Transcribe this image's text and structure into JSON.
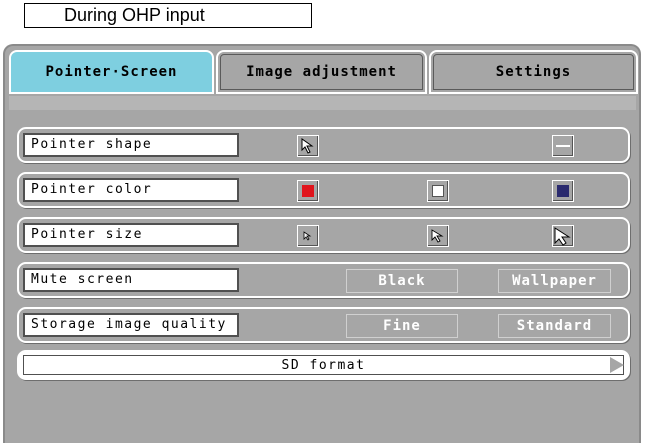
{
  "caption": "During OHP input",
  "tabs": [
    {
      "label": "Pointer·Screen",
      "active": true
    },
    {
      "label": "Image adjustment",
      "active": false
    },
    {
      "label": "Settings",
      "active": false
    }
  ],
  "rows": {
    "pointer_shape": {
      "label": "Pointer shape",
      "options": [
        "arrow-pointer-icon",
        "bar-pointer-icon"
      ]
    },
    "pointer_color": {
      "label": "Pointer color",
      "options": [
        "#e0141c",
        "#ffffff",
        "#2a2a6e"
      ]
    },
    "pointer_size": {
      "label": "Pointer size",
      "options": [
        "small-arrow-icon",
        "medium-arrow-icon",
        "large-arrow-icon"
      ]
    },
    "mute_screen": {
      "label": "Mute screen",
      "options": [
        "Black",
        "Wallpaper"
      ]
    },
    "storage_quality": {
      "label": "Storage image quality",
      "options": [
        "Fine",
        "Standard"
      ]
    }
  },
  "sd_format": {
    "label": "SD format"
  }
}
